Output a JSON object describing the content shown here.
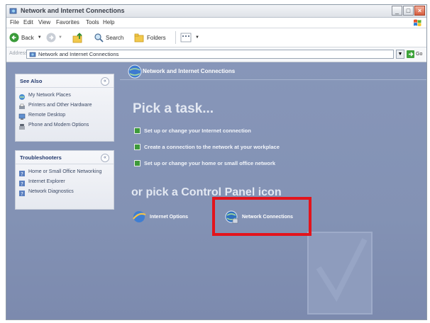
{
  "window": {
    "title": "Network and Internet Connections",
    "buttons": {
      "minimize": "_",
      "maximize": "□",
      "close": "×"
    }
  },
  "menu": [
    "File",
    "Edit",
    "View",
    "Favorites",
    "Tools",
    "Help"
  ],
  "toolbar": {
    "back": "Back",
    "search": "Search",
    "folders": "Folders"
  },
  "address": {
    "label": "Address",
    "value": "Network and Internet Connections",
    "go": "Go"
  },
  "see_also": {
    "title": "See Also",
    "collapse": "«",
    "items": [
      "My Network Places",
      "Printers and Other Hardware",
      "Remote Desktop",
      "Phone and Modem Options"
    ]
  },
  "troubleshooters": {
    "title": "Troubleshooters",
    "collapse": "«",
    "items": [
      "Home or Small Office Networking",
      "Internet Explorer",
      "Network Diagnostics"
    ]
  },
  "main": {
    "section_title": "Network and Internet Connections",
    "pick_task": "Pick a task...",
    "tasks": [
      "Set up or change your Internet connection",
      "Create a connection to the network at your workplace",
      "Set up or change your home or small office network"
    ],
    "pick_icon": "or pick a Control Panel icon",
    "icons": [
      "Internet Options",
      "Network Connections"
    ]
  },
  "colors": {
    "content_bg": "#8796b9",
    "highlight": "#e3141c",
    "panel_title": "#243a6e"
  }
}
